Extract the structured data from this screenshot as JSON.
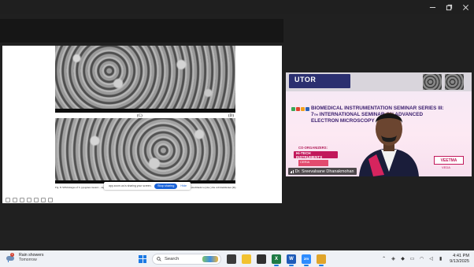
{
  "window": {
    "controls": [
      {
        "name": "minimize-icon",
        "glyph": "—"
      },
      {
        "name": "maximize-icon",
        "glyph": "▢"
      },
      {
        "name": "close-icon",
        "glyph": "✕"
      }
    ]
  },
  "shared_screen": {
    "panel_labels": {
      "c": "(C)",
      "d": "(D)"
    },
    "caption": "Fig. 8: SEM images of S. pyogenes treated ... ing rupture of cell membrane (B), distortion or swelling of bacterial cell surface (C), and attachment to (also ) the cell membranes (D).",
    "sharing_bar": {
      "message": "app.zoom.us is sharing your screen.",
      "stop_label": "Stop sharing",
      "hide_label": "Hide"
    }
  },
  "video": {
    "logo_text": "UTOR",
    "slide_title_line1": "BIOMEDICAL INSTRUMENTATION SEMINAR SERIES III:",
    "slide_title_line2_num": "7",
    "slide_title_line2_sup": "TH",
    "slide_title_line2_rest": " INTERNATIONAL SEMINAR ON ADVANCED",
    "slide_title_line3": "ELECTRON MICROSCOPY",
    "coorganizers_label": "CO-ORGANIZERS:",
    "sponsor1": "Hi-TECH INSTRUMENTS",
    "sponsor2": "CERIA",
    "sponsor3": "VEETMA",
    "sponsor4": "VEDA",
    "participant_name": "Dr. Sreevalsane Dhanakmohan"
  },
  "taskbar": {
    "weather": {
      "badge": "1",
      "title": "Rain showers",
      "subtitle": "Tomorrow"
    },
    "search_placeholder": "Search",
    "apps": [
      {
        "name": "task-view-icon",
        "color": "#3a3a3a",
        "label": ""
      },
      {
        "name": "file-explorer-icon",
        "color": "#f2c230",
        "label": ""
      },
      {
        "name": "notepad-app-icon",
        "color": "#2f2f2f",
        "label": ""
      },
      {
        "name": "excel-icon",
        "color": "#1d7a44",
        "label": "X"
      },
      {
        "name": "word-icon",
        "color": "#1e5bb8",
        "label": "W"
      },
      {
        "name": "zoom-icon",
        "color": "#2d8cff",
        "label": "zm"
      },
      {
        "name": "chrome-icon",
        "color": "#e0a52a",
        "label": ""
      }
    ],
    "tray_icons": [
      "chevron-up-icon",
      "meet-now-icon",
      "shield-icon",
      "display-icon",
      "wifi-icon",
      "volume-icon",
      "battery-icon"
    ],
    "time": "4:41 PM",
    "date": "9/13/2025"
  }
}
